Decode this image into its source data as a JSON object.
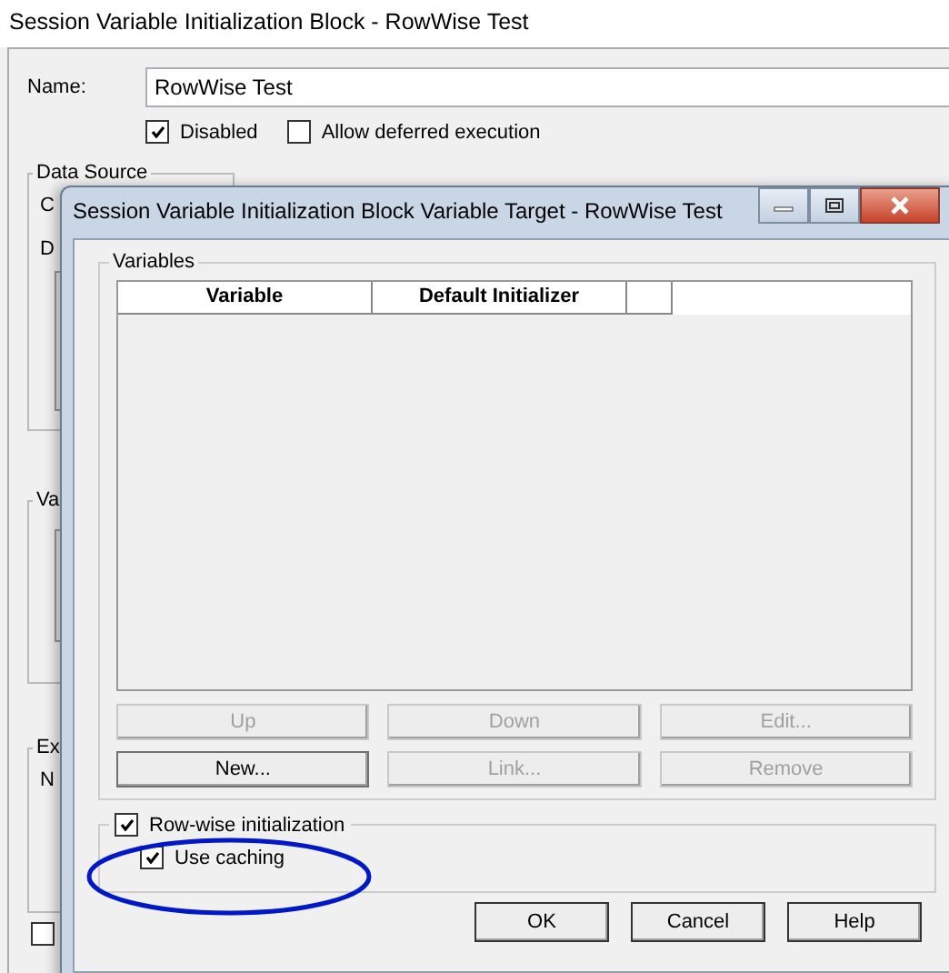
{
  "back_window": {
    "title": "Session Variable Initialization Block - RowWise Test",
    "name_label": "Name:",
    "name_value": "RowWise Test",
    "options": [
      {
        "label": "Disabled",
        "checked": true
      },
      {
        "label": "Allow deferred execution",
        "checked": false
      }
    ],
    "data_source": {
      "legend": "Data Source",
      "line_1": "C",
      "line_2": "D"
    },
    "group_2": {
      "legend": "Va"
    },
    "group_3": {
      "legend": "Ex",
      "line_1": "N"
    },
    "bottom_checkbox": {
      "checked": false
    }
  },
  "dialog": {
    "title": "Session Variable Initialization Block Variable Target - RowWise Test",
    "variables": {
      "legend": "Variables",
      "columns": [
        "Variable",
        "Default Initializer"
      ]
    },
    "list_buttons": [
      {
        "label": "Up",
        "disabled": true
      },
      {
        "label": "Down",
        "disabled": true
      },
      {
        "label": "Edit...",
        "disabled": true
      },
      {
        "label": "New...",
        "disabled": false
      },
      {
        "label": "Link...",
        "disabled": true
      },
      {
        "label": "Remove",
        "disabled": true
      }
    ],
    "row_wise": {
      "label": "Row-wise initialization",
      "checked": true
    },
    "use_caching": {
      "label": "Use caching",
      "checked": true
    },
    "buttons": [
      "OK",
      "Cancel",
      "Help"
    ]
  }
}
